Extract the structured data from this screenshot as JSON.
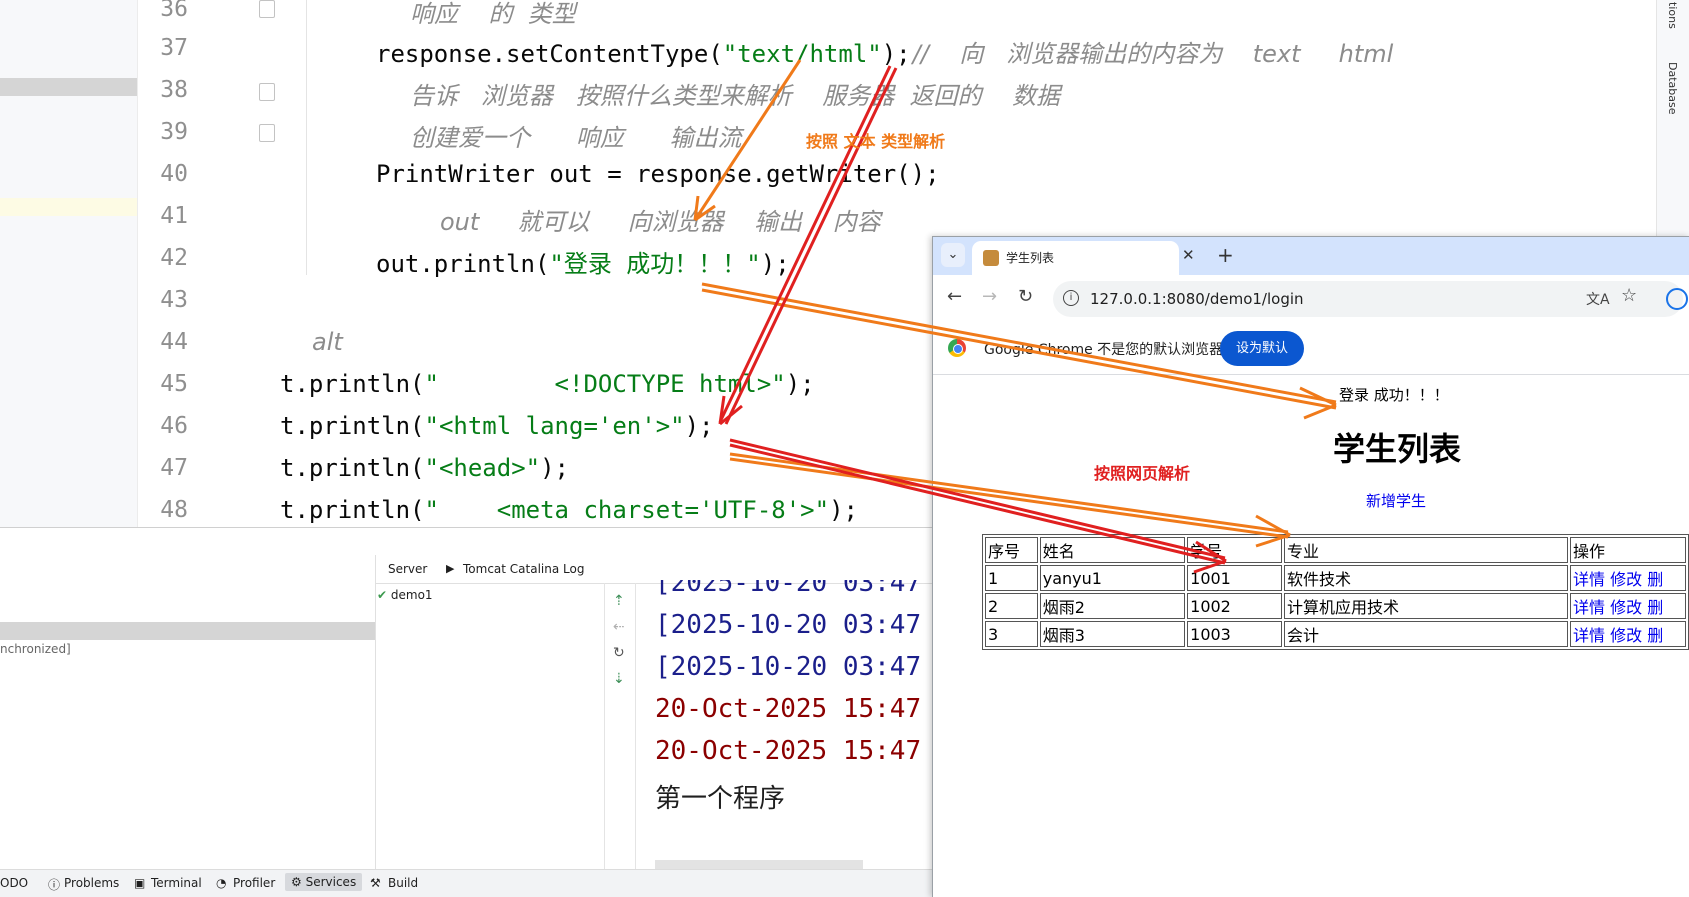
{
  "editor": {
    "line_numbers": [
      "36",
      "37",
      "38",
      "39",
      "40",
      "41",
      "42",
      "43",
      "44",
      "45",
      "46",
      "47",
      "48"
    ],
    "line36_comment": "响应    的  类型",
    "line37_code": "response.setContentType(",
    "line37_string": "\"text/html\"",
    "line37_rest": ");",
    "line37_comment": "//    向   浏览器输出的内容为    text     html",
    "line38_comment": "告诉   浏览器   按照什么类型来解析    服务器  返回的    数据",
    "line39_comment": "创建爱一个      响应      输出流",
    "line40_code": "PrintWriter out = response.getWriter();",
    "line41_comment": "out     就可以     向浏览器    输出    内容",
    "line42_code": "out.println(",
    "line42_string": "\"登录 成功！！！\"",
    "line42_rest": ");",
    "line44_comment": "alt",
    "line45_code": "t.println(",
    "line45_string": "\"        <!DOCTYPE html>\"",
    "line45_rest": ");",
    "line46_code": "t.println(",
    "line46_string": "\"<html lang='en'>\"",
    "line46_rest": ");",
    "line47_code": "t.println(",
    "line47_string": "\"<head>\"",
    "line47_rest": ");",
    "line48_code": "t.println(",
    "line48_string": "\"    <meta charset='UTF-8'>\"",
    "line48_rest": ");"
  },
  "right_strip": {
    "label_top": "tions",
    "label_database": "Database"
  },
  "services": {
    "sync_label": "nchronized]",
    "tabs": [
      "Server",
      "Tomcat Catalina Log"
    ],
    "tree_item": "demo1",
    "log_lines": [
      "[2025-10-20 03:47",
      "[2025-10-20 03:47",
      "[2025-10-20 03:47",
      "20-Oct-2025 15:47",
      "20-Oct-2025 15:47",
      "第一个程序"
    ]
  },
  "statusbar": {
    "items": [
      "ODO",
      "Problems",
      "Terminal",
      "Profiler",
      "Services",
      "Build"
    ]
  },
  "browser": {
    "tab_title": "学生列表",
    "url": "127.0.0.1:8080/demo1/login",
    "infobar_text": "Google Chrome 不是您的默认浏览器",
    "default_button": "设为默认"
  },
  "page": {
    "login_message": "登录 成功！！！",
    "heading": "学生列表",
    "add_link": "新增学生",
    "table_headers": [
      "序号",
      "姓名",
      "学号",
      "专业",
      "操作"
    ],
    "rows": [
      {
        "no": "1",
        "name": "yanyu1",
        "sid": "1001",
        "major": "软件技术"
      },
      {
        "no": "2",
        "name": "烟雨2",
        "sid": "1002",
        "major": "计算机应用技术"
      },
      {
        "no": "3",
        "name": "烟雨3",
        "sid": "1003",
        "major": "会计"
      }
    ],
    "action_detail": "详情",
    "action_edit": "修改",
    "action_delete_partial": "删"
  },
  "annotations": {
    "text_parse": "按照  文本  类型解析",
    "html_parse": "按照网页解析",
    "color_orange": "#f07a1a",
    "color_red": "#e02020"
  }
}
